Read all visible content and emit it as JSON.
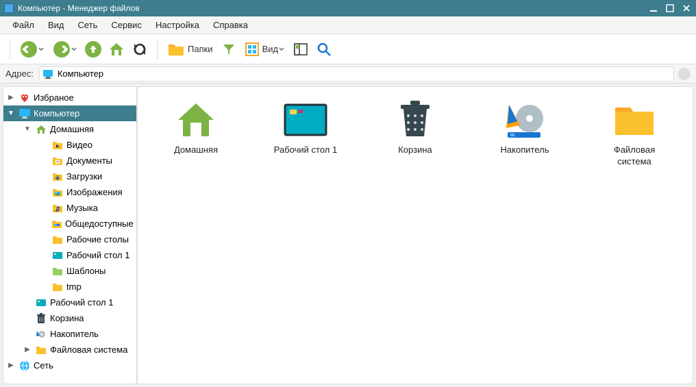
{
  "window": {
    "title": "Компьютер  - Менеджер файлов"
  },
  "menubar": [
    "Файл",
    "Вид",
    "Сеть",
    "Сервис",
    "Настройка",
    "Справка"
  ],
  "toolbar": {
    "folders_label": "Папки",
    "view_label": "Вид"
  },
  "addressbar": {
    "label": "Адрес:",
    "path": "Компьютер"
  },
  "tree": {
    "favorites": "Избраное",
    "computer": "Компьютер",
    "home": "Домашняя",
    "video": "Видео",
    "documents": "Документы",
    "downloads": "Загрузки",
    "images": "Изображения",
    "music": "Музыка",
    "public": "Общедоступные",
    "desktops": "Рабочие столы",
    "desktop1": "Рабочий стол 1",
    "templates": "Шаблоны",
    "tmp": "tmp",
    "desktop1b": "Рабочий стол 1",
    "trash": "Корзина",
    "drive": "Накопитель",
    "filesystem": "Файловая система",
    "network": "Сеть"
  },
  "grid": {
    "home": "Домашняя",
    "desktop": "Рабочий стол 1",
    "trash": "Корзина",
    "drive": "Накопитель",
    "filesystem": "Файловая система"
  }
}
